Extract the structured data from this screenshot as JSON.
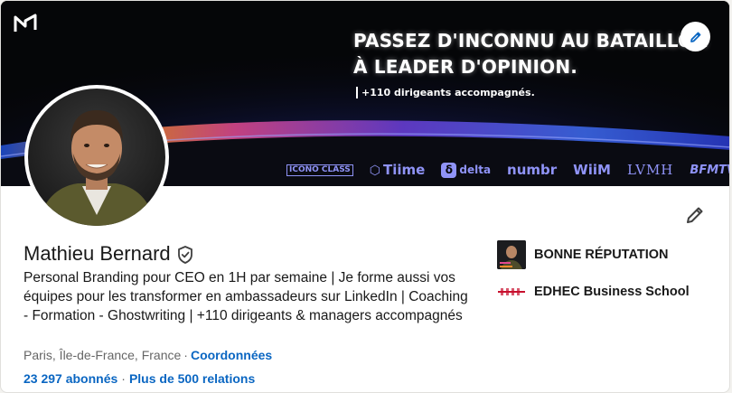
{
  "banner": {
    "headline_line1": "PASSEZ D'INCONNU AU BATAILLON",
    "headline_line2": "À LEADER D'OPINION.",
    "tagline": "+110 dirigeants accompagnés.",
    "brands": [
      "ICONO CLASS",
      "Tiime",
      "delta",
      "numbr",
      "WiiM",
      "LVMH",
      "BFMTV"
    ],
    "edit_icon": "pencil-icon",
    "logo_icon": "n-logo-icon"
  },
  "profile": {
    "name": "Mathieu Bernard",
    "verified_icon": "verified-shield-icon",
    "headline": "Personal Branding pour CEO en 1H par semaine | Je forme aussi vos équipes pour les transformer en ambassadeurs sur LinkedIn | Coaching - Formation - Ghostwriting | +110 dirigeants & managers accompagnés",
    "location": "Paris, Île-de-France, France",
    "location_sep": "·",
    "contact_link": "Coordonnées",
    "followers": "23 297 abonnés",
    "stats_sep": "·",
    "connections": "Plus de 500 relations",
    "edit_icon": "pencil-icon"
  },
  "affiliations": [
    {
      "label": "BONNE RÉPUTATION",
      "logo_text": "BONNE RÉPUTATION"
    },
    {
      "label": "EDHEC Business School",
      "logo_text": "EDHEC"
    }
  ],
  "colors": {
    "link": "#0a66c2",
    "text": "#191919",
    "muted": "#666666",
    "brand_violet": "#8f93f7"
  }
}
